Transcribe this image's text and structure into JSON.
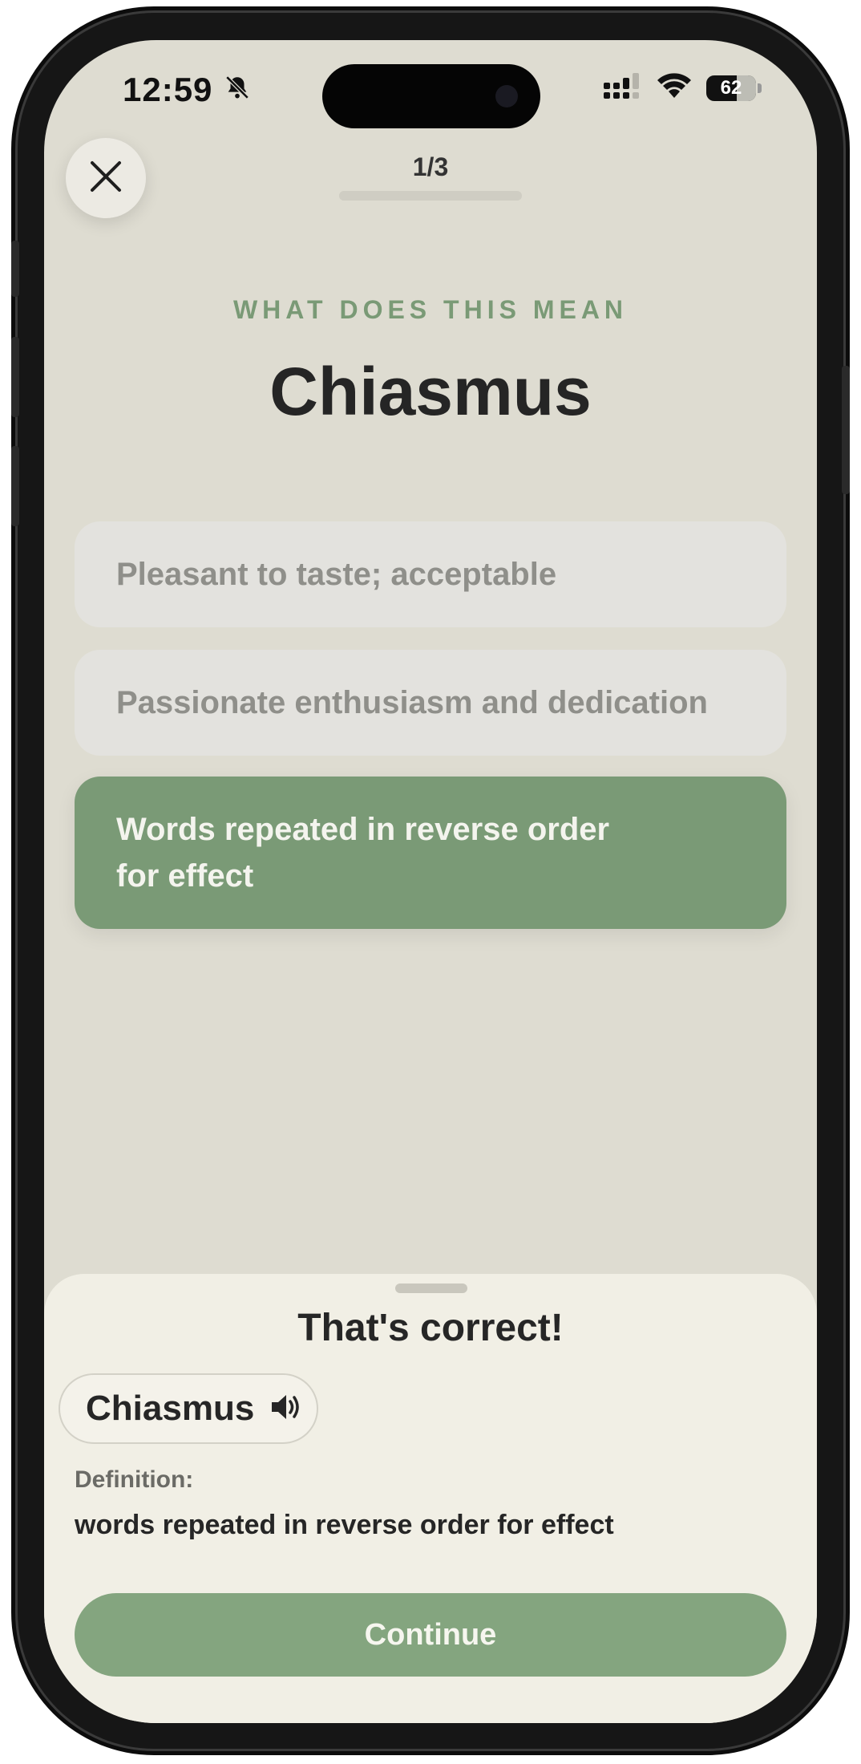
{
  "status_bar": {
    "time": "12:59",
    "battery": "62",
    "icons": [
      "bell-slash-icon",
      "signal-icon",
      "wifi-icon",
      "battery-icon"
    ]
  },
  "header": {
    "progress_label": "1/3",
    "progress_fraction": 0.33,
    "close_icon": "close-icon"
  },
  "question": {
    "prompt": "WHAT DOES THIS MEAN",
    "term": "Chiasmus"
  },
  "options": [
    {
      "text": "Pleasant to taste; acceptable",
      "state": "neutral"
    },
    {
      "text": "Passionate enthusiasm and dedication",
      "state": "neutral"
    },
    {
      "text_line1": "Words repeated in reverse order",
      "text_line2": "for effect",
      "state": "correct"
    }
  ],
  "result_sheet": {
    "title": "That's correct!",
    "term": "Chiasmus",
    "speaker_icon": "speaker-icon",
    "definition_label": "Definition:",
    "definition": "words repeated in reverse order for effect",
    "continue_label": "Continue"
  },
  "colors": {
    "background": "#dedcd1",
    "accent_green": "#7a9a76",
    "button_green": "#84a57f",
    "sheet": "#f1efe5",
    "neutral_option": "#e3e2de"
  }
}
